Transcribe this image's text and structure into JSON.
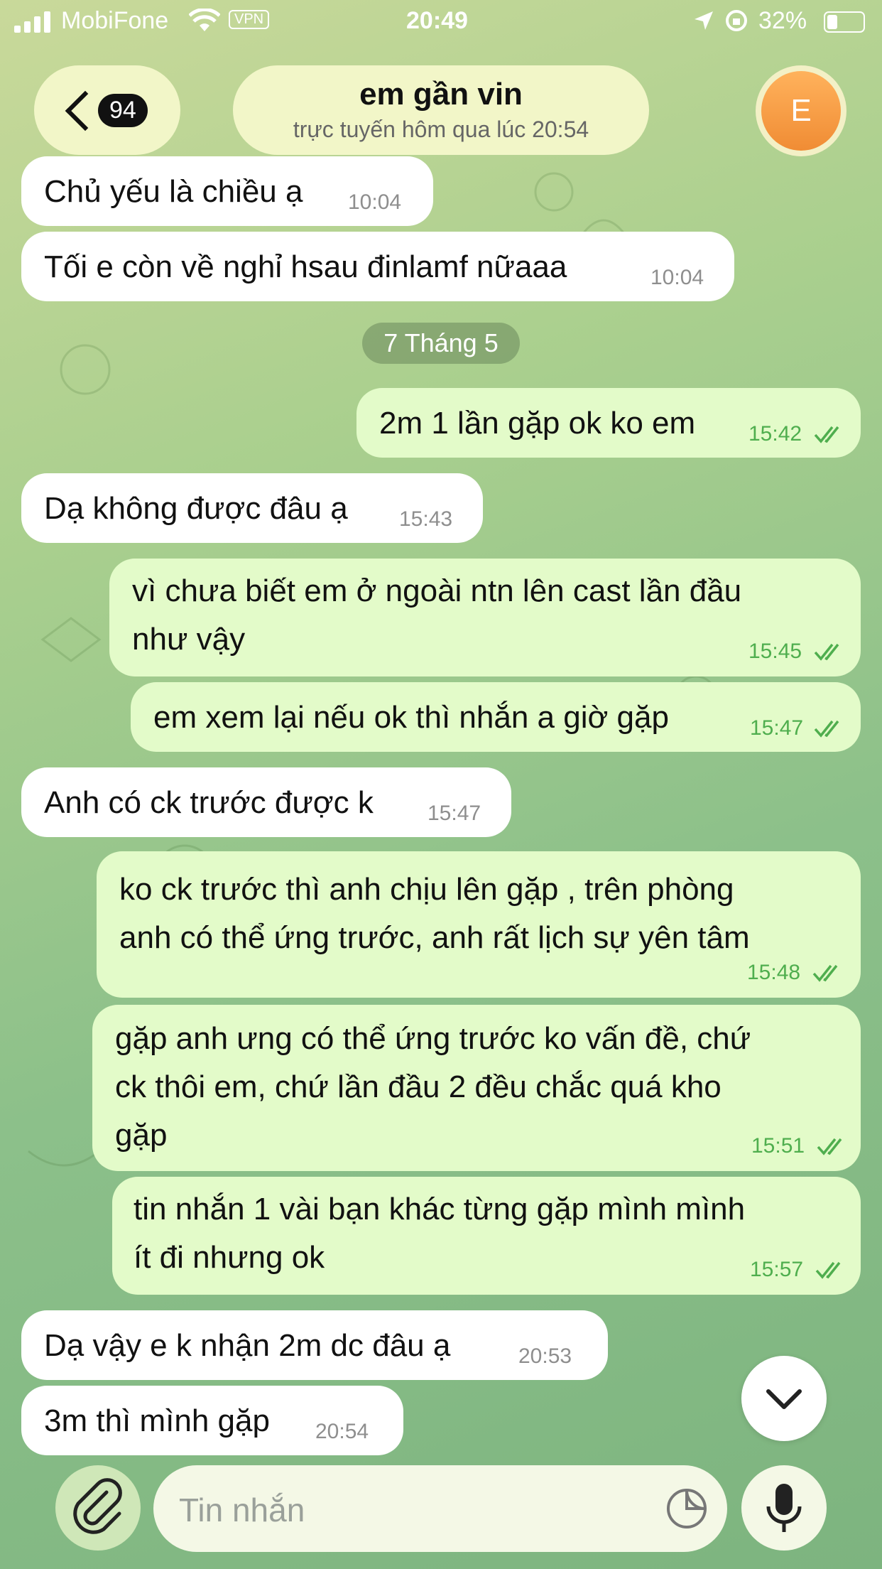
{
  "status_bar": {
    "carrier": "MobiFone",
    "vpn": "VPN",
    "time": "20:49",
    "battery": "32%"
  },
  "header": {
    "unread_count": "94",
    "contact_name": "em gần vin",
    "last_seen": "trực tuyến hôm qua lúc 20:54",
    "avatar_letter": "E"
  },
  "date_separator": "7 Tháng 5",
  "messages": [
    {
      "dir": "in",
      "text": "Chủ yếu là chiều ạ",
      "time": "10:04"
    },
    {
      "dir": "in",
      "text": "Tối e còn về nghỉ hsau đinlamf nữaaa",
      "time": "10:04"
    },
    {
      "dir": "out",
      "text": "2m 1 lần gặp ok ko em",
      "time": "15:42"
    },
    {
      "dir": "in",
      "text": "Dạ không được đâu ạ",
      "time": "15:43"
    },
    {
      "dir": "out",
      "line1": "vì chưa biết em ở ngoài ntn lên cast lần đầu",
      "line2": "như vậy",
      "time": "15:45"
    },
    {
      "dir": "out",
      "text": "em xem lại nếu ok thì nhắn a giờ gặp",
      "time": "15:47"
    },
    {
      "dir": "in",
      "text": "Anh có ck trước được k",
      "time": "15:47"
    },
    {
      "dir": "out",
      "line1": "ko ck trước thì anh chịu lên gặp , trên phòng",
      "line2": "anh có thể ứng trước, anh rất lịch sự yên tâm",
      "time": "15:48"
    },
    {
      "dir": "out",
      "line1": "gặp anh ưng có thể ứng trước ko vấn đề, chứ",
      "line2": "ck thôi em, chứ lần đầu 2 đều chắc quá kho",
      "line3": "gặp",
      "time": "15:51"
    },
    {
      "dir": "out",
      "line1": "tin nhắn 1 vài bạn khác từng gặp mình mình",
      "line2": "ít đi nhưng ok",
      "time": "15:57"
    },
    {
      "dir": "in",
      "text": "Dạ vậy e k nhận 2m dc đâu ạ",
      "time": "20:53"
    },
    {
      "dir": "in",
      "text": "3m thì mình gặp",
      "time": "20:54"
    }
  ],
  "composer": {
    "placeholder": "Tin nhắn"
  },
  "colors": {
    "incoming_bubble": "#ffffff",
    "outgoing_bubble": "#e3fbc9",
    "outgoing_time": "#4fae4e",
    "avatar": "#f5a046"
  },
  "icons": [
    "back-chevron-icon",
    "wifi-icon",
    "signal-icon",
    "location-icon",
    "battery-icon",
    "double-check-icon",
    "chevron-down-icon",
    "paperclip-icon",
    "sticker-icon",
    "microphone-icon"
  ]
}
